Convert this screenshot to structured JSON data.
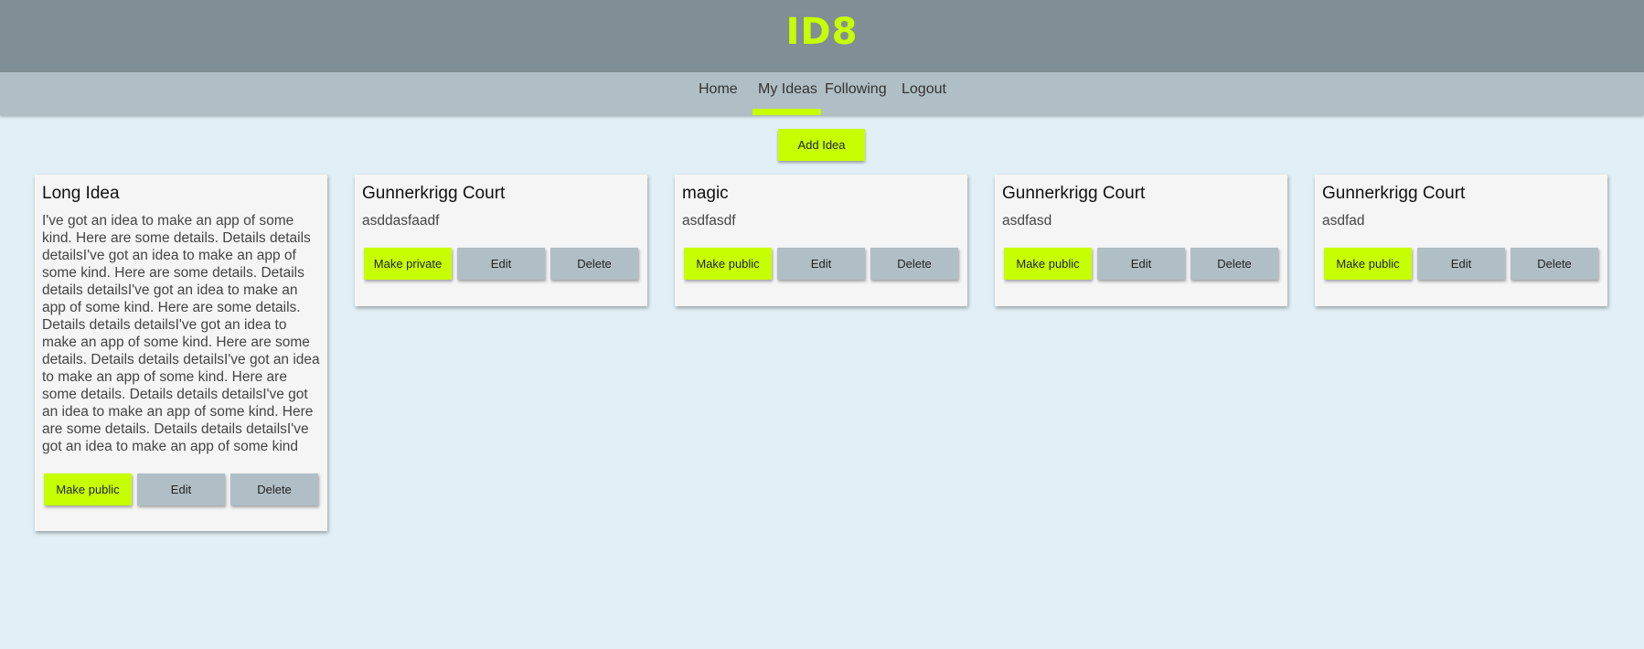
{
  "header": {
    "logo": "ID8"
  },
  "nav": {
    "items": [
      {
        "label": "Home"
      },
      {
        "label": "My Ideas",
        "active": true
      },
      {
        "label": "Following"
      },
      {
        "label": "Logout"
      }
    ]
  },
  "actions": {
    "add_idea_label": "Add Idea"
  },
  "colors": {
    "header_bg": "#808e95",
    "nav_bg": "#b0bec5",
    "page_bg": "#e1f0f6",
    "accent": "#c6ff00",
    "card_bg": "#f5f5f5"
  },
  "ideas": [
    {
      "title": "Long Idea",
      "details": "I've got an idea to make an app of some kind. Here are some details. Details details detailsI've got an idea to make an app of some kind. Here are some details. Details details detailsI've got an idea to make an app of some kind. Here are some details. Details details detailsI've got an idea to make an app of some kind. Here are some details. Details details detailsI've got an idea to make an app of some kind. Here are some details. Details details detailsI've got an idea to make an app of some kind. Here are some details. Details details detailsI've got an idea to make an app of some kind",
      "toggle_label": "Make public",
      "edit_label": "Edit",
      "delete_label": "Delete"
    },
    {
      "title": "Gunnerkrigg Court",
      "details": "asddasfaadf",
      "toggle_label": "Make private",
      "edit_label": "Edit",
      "delete_label": "Delete"
    },
    {
      "title": "magic",
      "details": "asdfasdf",
      "toggle_label": "Make public",
      "edit_label": "Edit",
      "delete_label": "Delete"
    },
    {
      "title": "Gunnerkrigg Court",
      "details": "asdfasd",
      "toggle_label": "Make public",
      "edit_label": "Edit",
      "delete_label": "Delete"
    },
    {
      "title": "Gunnerkrigg Court",
      "details": "asdfad",
      "toggle_label": "Make public",
      "edit_label": "Edit",
      "delete_label": "Delete"
    }
  ]
}
